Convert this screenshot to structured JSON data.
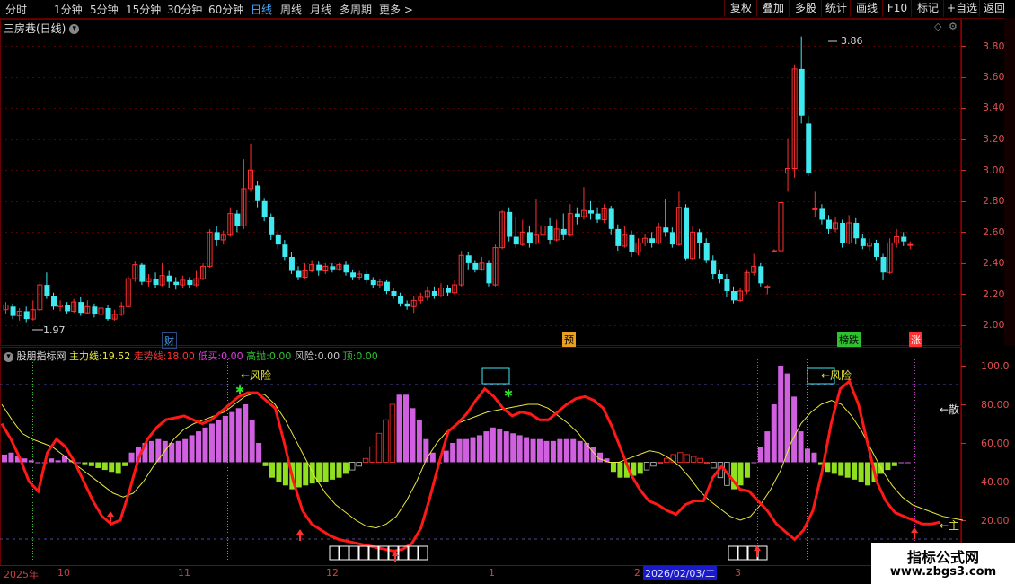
{
  "toolbar": {
    "periods": [
      "分时",
      "1分钟",
      "5分钟",
      "15分钟",
      "30分钟",
      "60分钟",
      "日线",
      "周线",
      "月线",
      "多周期",
      "更多 >"
    ],
    "active_period": "日线",
    "buttons": [
      "复权",
      "叠加",
      "多股",
      "统计",
      "画线",
      "F10",
      "标记",
      "+自选",
      "返回"
    ]
  },
  "chart_title": "三房巷(日线)",
  "price_axis": [
    "3.80",
    "3.60",
    "3.40",
    "3.20",
    "3.00",
    "2.80",
    "2.60",
    "2.40",
    "2.20",
    "2.00"
  ],
  "price_annotations": {
    "high": "3.86",
    "low": "1.97"
  },
  "event_markers": [
    {
      "label": "财",
      "color": "#4aa8ff"
    },
    {
      "label": "预",
      "color": "#e8a020"
    },
    {
      "label": "榜跌",
      "color": "#30c030"
    },
    {
      "label": "涨",
      "color": "#ff3030"
    }
  ],
  "indicator": {
    "name": "股朋指标网",
    "items": [
      {
        "label": "主力线:",
        "value": "19.52",
        "color": "#e8e840"
      },
      {
        "label": "走势线:",
        "value": "18.00",
        "color": "#ff3030"
      },
      {
        "label": "低买:",
        "value": "0.00",
        "color": "#e040e0"
      },
      {
        "label": "高抛:",
        "value": "0.00",
        "color": "#30c030"
      },
      {
        "label": "风险:",
        "value": "0.00",
        "color": "#c8c8c8"
      },
      {
        "label": "顶:",
        "value": "0.00",
        "color": "#30c030"
      }
    ],
    "axis": [
      "100.0",
      "80.00",
      "60.00",
      "40.00",
      "20.00"
    ],
    "risk_label_1": "←风险",
    "risk_label_2": "←风险",
    "san_label": "←散",
    "zhu_label": "←主"
  },
  "date_axis": {
    "year": "2025年",
    "months": [
      "10",
      "11",
      "12",
      "1",
      "2",
      "3"
    ],
    "cursor_date": "2026/02/03/二"
  },
  "watermark": {
    "title": "指标公式网",
    "url": "www.zbgs3.com"
  },
  "colors": {
    "up": "#ff3030",
    "down": "#40e8f0",
    "main_line": "#ff1818",
    "trend_line": "#e8e840",
    "pos_bar": "#d060e0",
    "neg_bar": "#90e020"
  }
}
